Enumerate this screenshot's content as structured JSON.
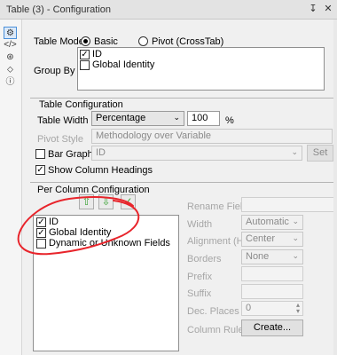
{
  "window": {
    "title": "Table (3) - Configuration",
    "pin_icon": "pin-icon",
    "close_icon": "close-icon"
  },
  "left_strip": {
    "icons": [
      "gear-icon",
      "code-icon",
      "settings-circle-icon",
      "tag-icon",
      "help-icon"
    ]
  },
  "table_mode": {
    "label": "Table Mode",
    "options": [
      "Basic",
      "Pivot (CrossTab)"
    ],
    "selected": "Basic"
  },
  "group_by": {
    "label": "Group By",
    "items": [
      {
        "label": "ID",
        "checked": true
      },
      {
        "label": "Global Identity",
        "checked": false
      }
    ]
  },
  "table_configuration": {
    "header": "Table Configuration",
    "table_width_label": "Table Width",
    "table_width_value": "Percentage",
    "percent_value": "100",
    "percent_unit": "%",
    "pivot_style_label": "Pivot Style",
    "pivot_style_value": "Methodology over Variable",
    "bar_graph_label": "Bar Graph",
    "bar_graph_checked": false,
    "bar_graph_value": "ID",
    "set_button_label": "Set",
    "show_headings_label": "Show Column Headings",
    "show_headings_checked": true
  },
  "per_column": {
    "header": "Per Column Configuration",
    "move_up_icon": "arrow-up-icon",
    "move_down_icon": "arrow-down-icon",
    "check_icon": "check-icon",
    "items": [
      {
        "label": "ID",
        "checked": true
      },
      {
        "label": "Global Identity",
        "checked": true
      },
      {
        "label": "Dynamic or Unknown Fields",
        "checked": false
      }
    ],
    "rename_field_label": "Rename Field",
    "width_label": "Width",
    "width_value": "Automatic",
    "alignment_label": "Alignment (H)",
    "alignment_value": "Center",
    "borders_label": "Borders",
    "borders_value": "None",
    "prefix_label": "Prefix",
    "suffix_label": "Suffix",
    "dec_places_label": "Dec. Places",
    "dec_places_value": "0",
    "column_rules_label": "Column Rules",
    "create_button_label": "Create..."
  },
  "colors": {
    "annotation_red": "#e8242b",
    "accent_blue": "#4a90d9",
    "arrow_green": "#3aa335"
  }
}
